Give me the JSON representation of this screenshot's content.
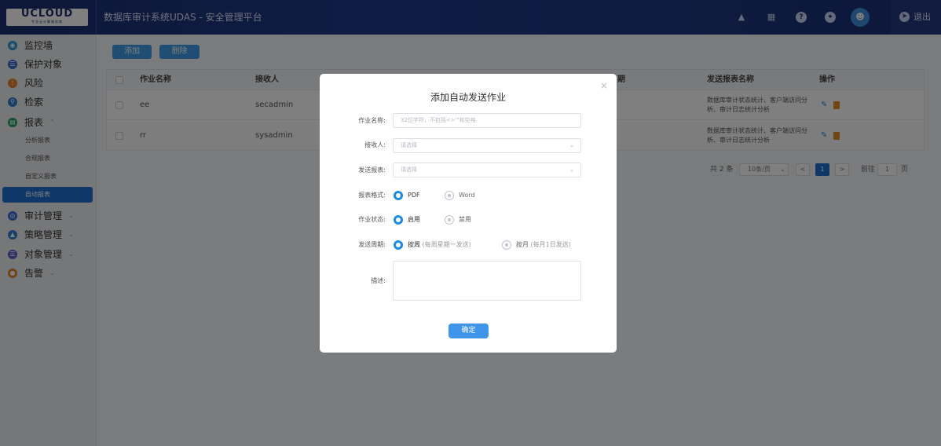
{
  "header": {
    "logo_text": "UCLOUD",
    "logo_sub": "专业云计算服务商",
    "title": "数据库审计系统UDAS - 安全管理平台",
    "icons": [
      "bell-icon",
      "fullscreen-icon",
      "help-icon",
      "settings-icon",
      "user-avatar-icon"
    ],
    "logout_label": "退出"
  },
  "sidebar": {
    "items": [
      {
        "label": "监控墙",
        "icon": "monitor-icon",
        "color": "#2e9bd6"
      },
      {
        "label": "保护对象",
        "icon": "database-icon",
        "color": "#3a6fd0"
      },
      {
        "label": "风险",
        "icon": "alert-icon",
        "color": "#e0842a"
      },
      {
        "label": "检索",
        "icon": "search-icon",
        "color": "#2e7fd0"
      },
      {
        "label": "报表",
        "icon": "report-icon",
        "color": "#1fa05a",
        "expanded": true
      }
    ],
    "sub_items": [
      {
        "label": "分析报表"
      },
      {
        "label": "合规报表"
      },
      {
        "label": "自定义报表"
      },
      {
        "label": "自动报表",
        "active": true
      }
    ],
    "bottom_items": [
      {
        "label": "审计管理",
        "icon": "audit-icon",
        "color": "#3a6fd0"
      },
      {
        "label": "策略管理",
        "icon": "policy-icon",
        "color": "#2e7fd0"
      },
      {
        "label": "对象管理",
        "icon": "object-icon",
        "color": "#5a5fcf"
      },
      {
        "label": "告警",
        "icon": "warning-icon",
        "color": "#e0842a"
      }
    ]
  },
  "toolbar": {
    "add_label": "添加",
    "delete_label": "删除"
  },
  "table": {
    "columns": [
      "作业名称",
      "接收人",
      "期",
      "发送报表名称",
      "操作"
    ],
    "rows": [
      {
        "name": "ee",
        "receiver": "secadmin",
        "reports": "数据库审计状态统计、客户端访问分析、审计日志统计分析"
      },
      {
        "name": "rr",
        "receiver": "sysadmin",
        "reports": "数据库审计状态统计、客户端访问分析、审计日志统计分析"
      }
    ]
  },
  "pagination": {
    "total_text": "共 2 条",
    "page_size": "10条/页",
    "current_page": "1",
    "goto_label": "前往",
    "goto_value": "1",
    "page_unit": "页"
  },
  "modal": {
    "title": "添加自动发送作业",
    "job_name_label": "作业名称:",
    "job_name_placeholder": "32位字符，不包括<>'\"和空格",
    "receiver_label": "接收人:",
    "receiver_placeholder": "请选择",
    "report_label": "发送报表:",
    "report_placeholder": "请选择",
    "format_label": "报表格式:",
    "format_options": [
      "PDF",
      "Word"
    ],
    "status_label": "作业状态:",
    "status_options": [
      "启用",
      "禁用"
    ],
    "period_label": "发送周期:",
    "period_weekly": "按周",
    "period_weekly_hint": "(每周星期一发送)",
    "period_monthly": "按月",
    "period_monthly_hint": "(每月1日发送)",
    "desc_label": "描述:",
    "confirm_label": "确定"
  }
}
